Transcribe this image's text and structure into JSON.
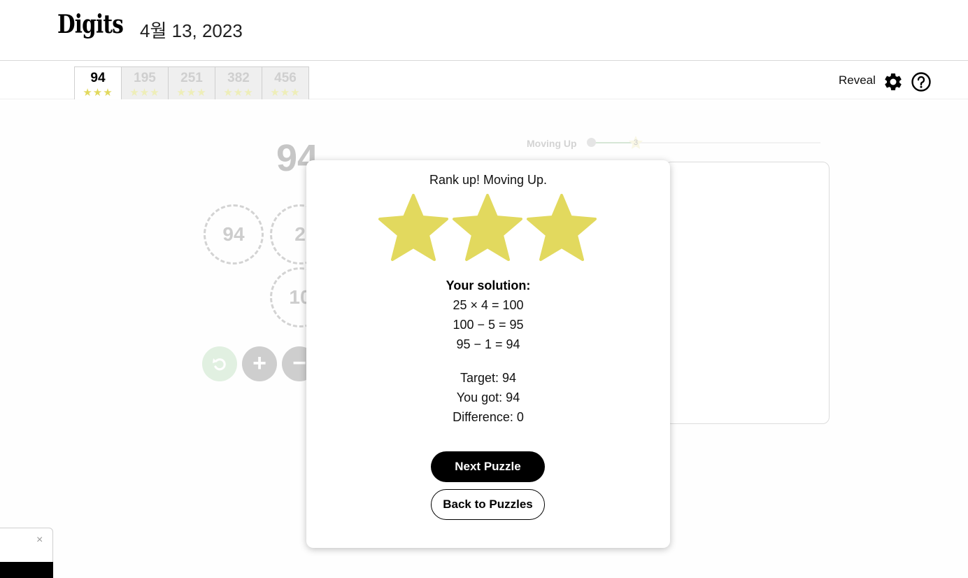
{
  "header": {
    "logo": "Digits",
    "date": "4월 13, 2023"
  },
  "tabs": [
    {
      "number": "94",
      "stars": "★★★",
      "active": true
    },
    {
      "number": "195",
      "stars": "★★★",
      "active": false
    },
    {
      "number": "251",
      "stars": "★★★",
      "active": false
    },
    {
      "number": "382",
      "stars": "★★★",
      "active": false
    },
    {
      "number": "456",
      "stars": "★★★",
      "active": false
    }
  ],
  "toolbar": {
    "reveal_label": "Reveal",
    "settings_icon": "gear-icon",
    "help_icon": "question-circle-icon"
  },
  "game": {
    "target": "94",
    "tiles": [
      "94",
      "2",
      "10"
    ],
    "operations": [
      "undo-icon",
      "plus-icon",
      "minus-icon"
    ],
    "progress_label": "Moving Up",
    "progress_marker": "3"
  },
  "modal": {
    "rank_text": "Rank up! Moving Up.",
    "stars_earned": 3,
    "solution_title": "Your solution:",
    "steps": [
      "25 × 4 = 100",
      "100 − 5 = 95",
      "95 − 1 = 94"
    ],
    "target_line": "Target: 94",
    "got_line": "You got: 94",
    "difference_line": "Difference: 0",
    "next_label": "Next Puzzle",
    "back_label": "Back to Puzzles"
  },
  "toast": {
    "close_label": "×"
  },
  "colors": {
    "star": "#e2d95e",
    "primary": "#000000",
    "undo": "#b9ddb9"
  }
}
